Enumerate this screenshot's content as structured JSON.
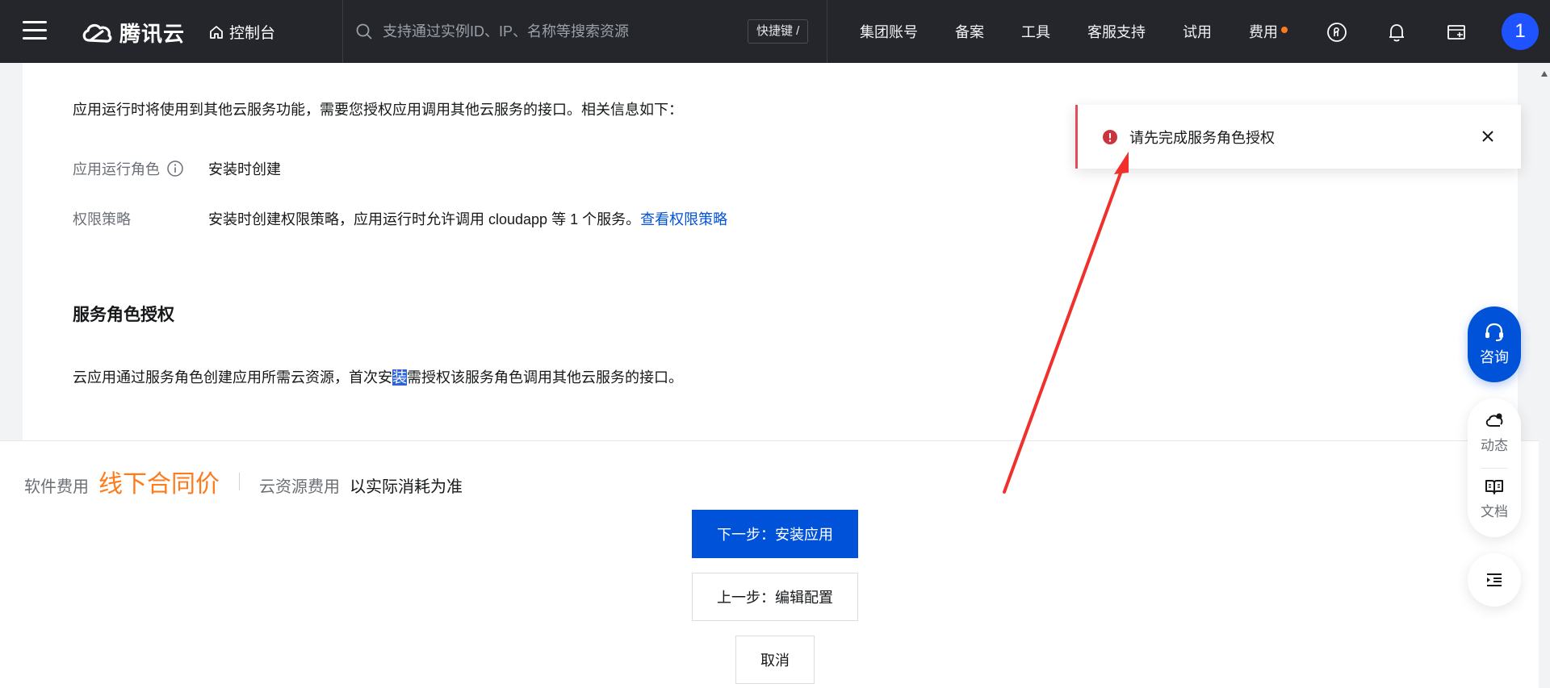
{
  "nav": {
    "brand": "腾讯云",
    "console_label": "控制台",
    "search_placeholder": "支持通过实例ID、IP、名称等搜索资源",
    "shortcut_label": "快捷键 /",
    "links": [
      "集团账号",
      "备案",
      "工具",
      "客服支持",
      "试用",
      "费用"
    ],
    "avatar_text": "1"
  },
  "content": {
    "intro": "应用运行时将使用到其他云服务功能，需要您授权应用调用其他云服务的接口。相关信息如下：",
    "role_label": "应用运行角色",
    "role_value": "安装时创建",
    "policy_label": "权限策略",
    "policy_value": "安装时创建权限策略，应用运行时允许调用 cloudapp 等 1 个服务。",
    "policy_link": "查看权限策略",
    "section_title": "服务角色授权",
    "desc_before": "云应用通过服务角色创建应用所需云资源，首次安",
    "desc_highlight": "装",
    "desc_after": "需授权该服务角色调用其他云服务的接口。"
  },
  "footer": {
    "software_fee_label": "软件费用",
    "software_fee_value": "线下合同价",
    "cloud_fee_label": "云资源费用",
    "cloud_fee_value": "以实际消耗为准",
    "next_button": "下一步：安装应用",
    "prev_button": "上一步：编辑配置",
    "cancel_button": "取消"
  },
  "toast": {
    "message": "请先完成服务角色授权"
  },
  "side": {
    "consult_label": "咨询",
    "news_label": "动态",
    "docs_label": "文档"
  },
  "colors": {
    "nav_bg": "#24262b",
    "primary": "#0052d9",
    "fee_orange": "#ff7a1a",
    "error_red": "#e34d59",
    "annotation_red": "#f0302b"
  }
}
